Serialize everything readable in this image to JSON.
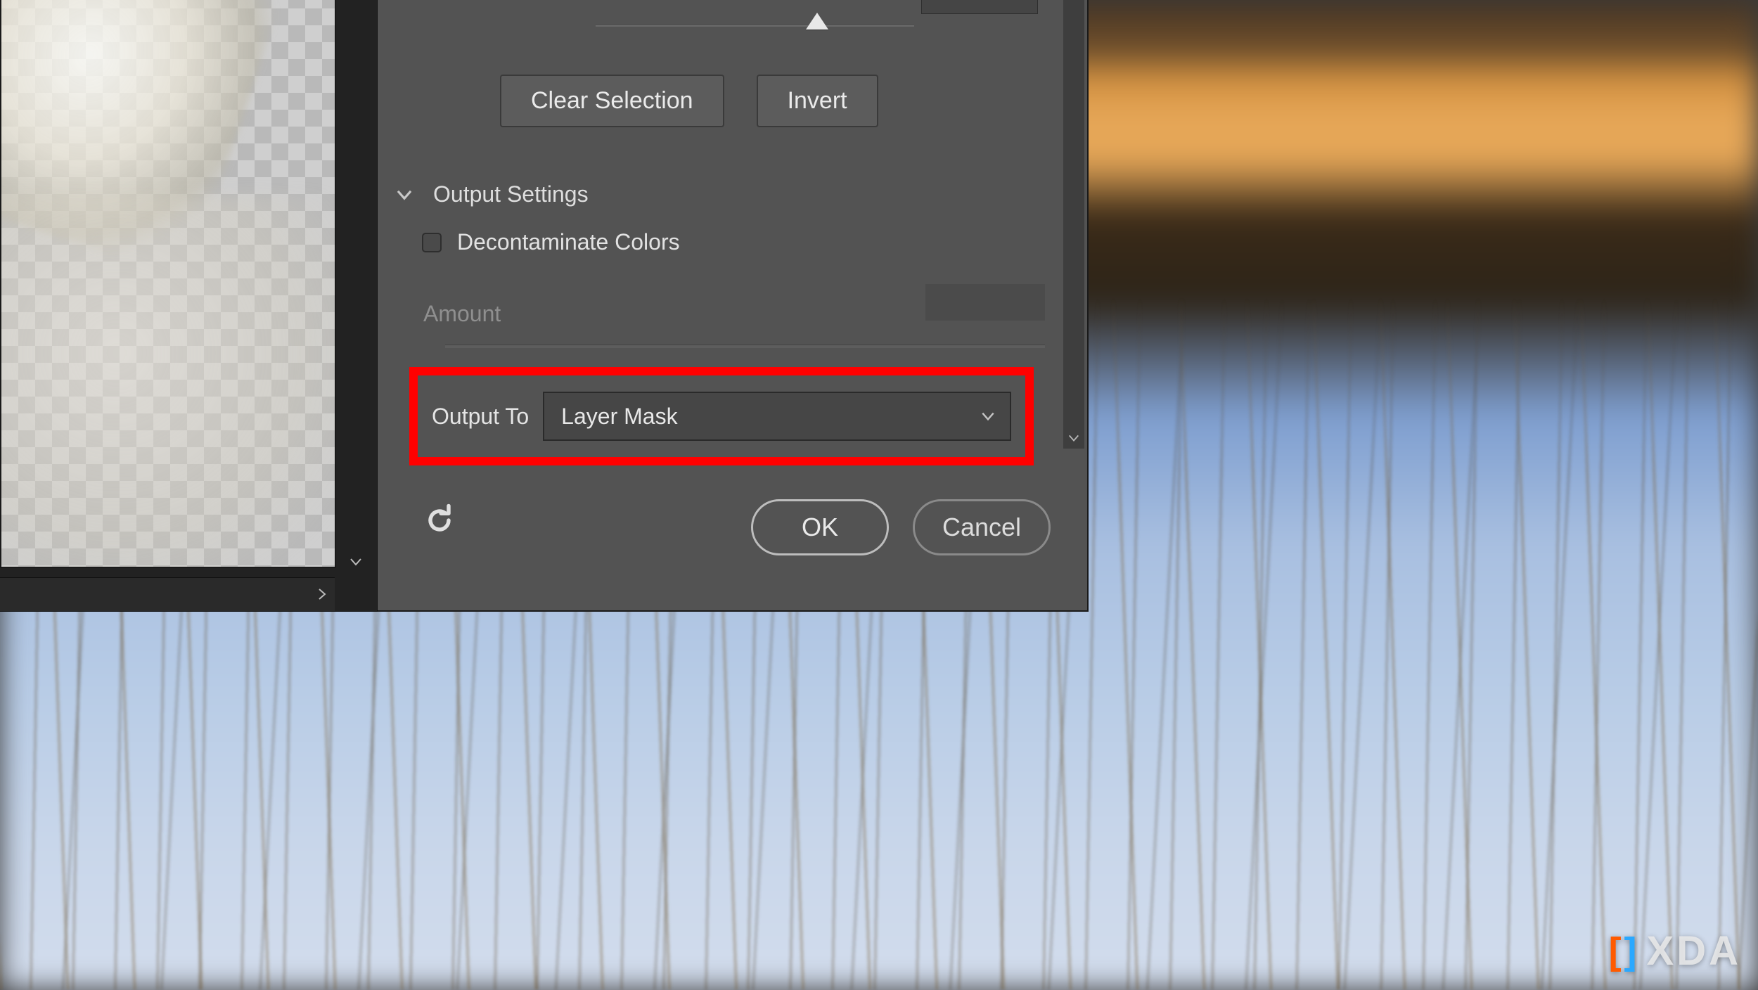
{
  "buttons": {
    "clear_selection": "Clear Selection",
    "invert": "Invert",
    "ok": "OK",
    "cancel": "Cancel"
  },
  "section": {
    "output_settings": "Output Settings"
  },
  "checkbox": {
    "decontaminate": "Decontaminate Colors"
  },
  "amount": {
    "label": "Amount"
  },
  "output_to": {
    "label": "Output To",
    "value": "Layer Mask"
  },
  "watermark": {
    "text": "XDA"
  }
}
